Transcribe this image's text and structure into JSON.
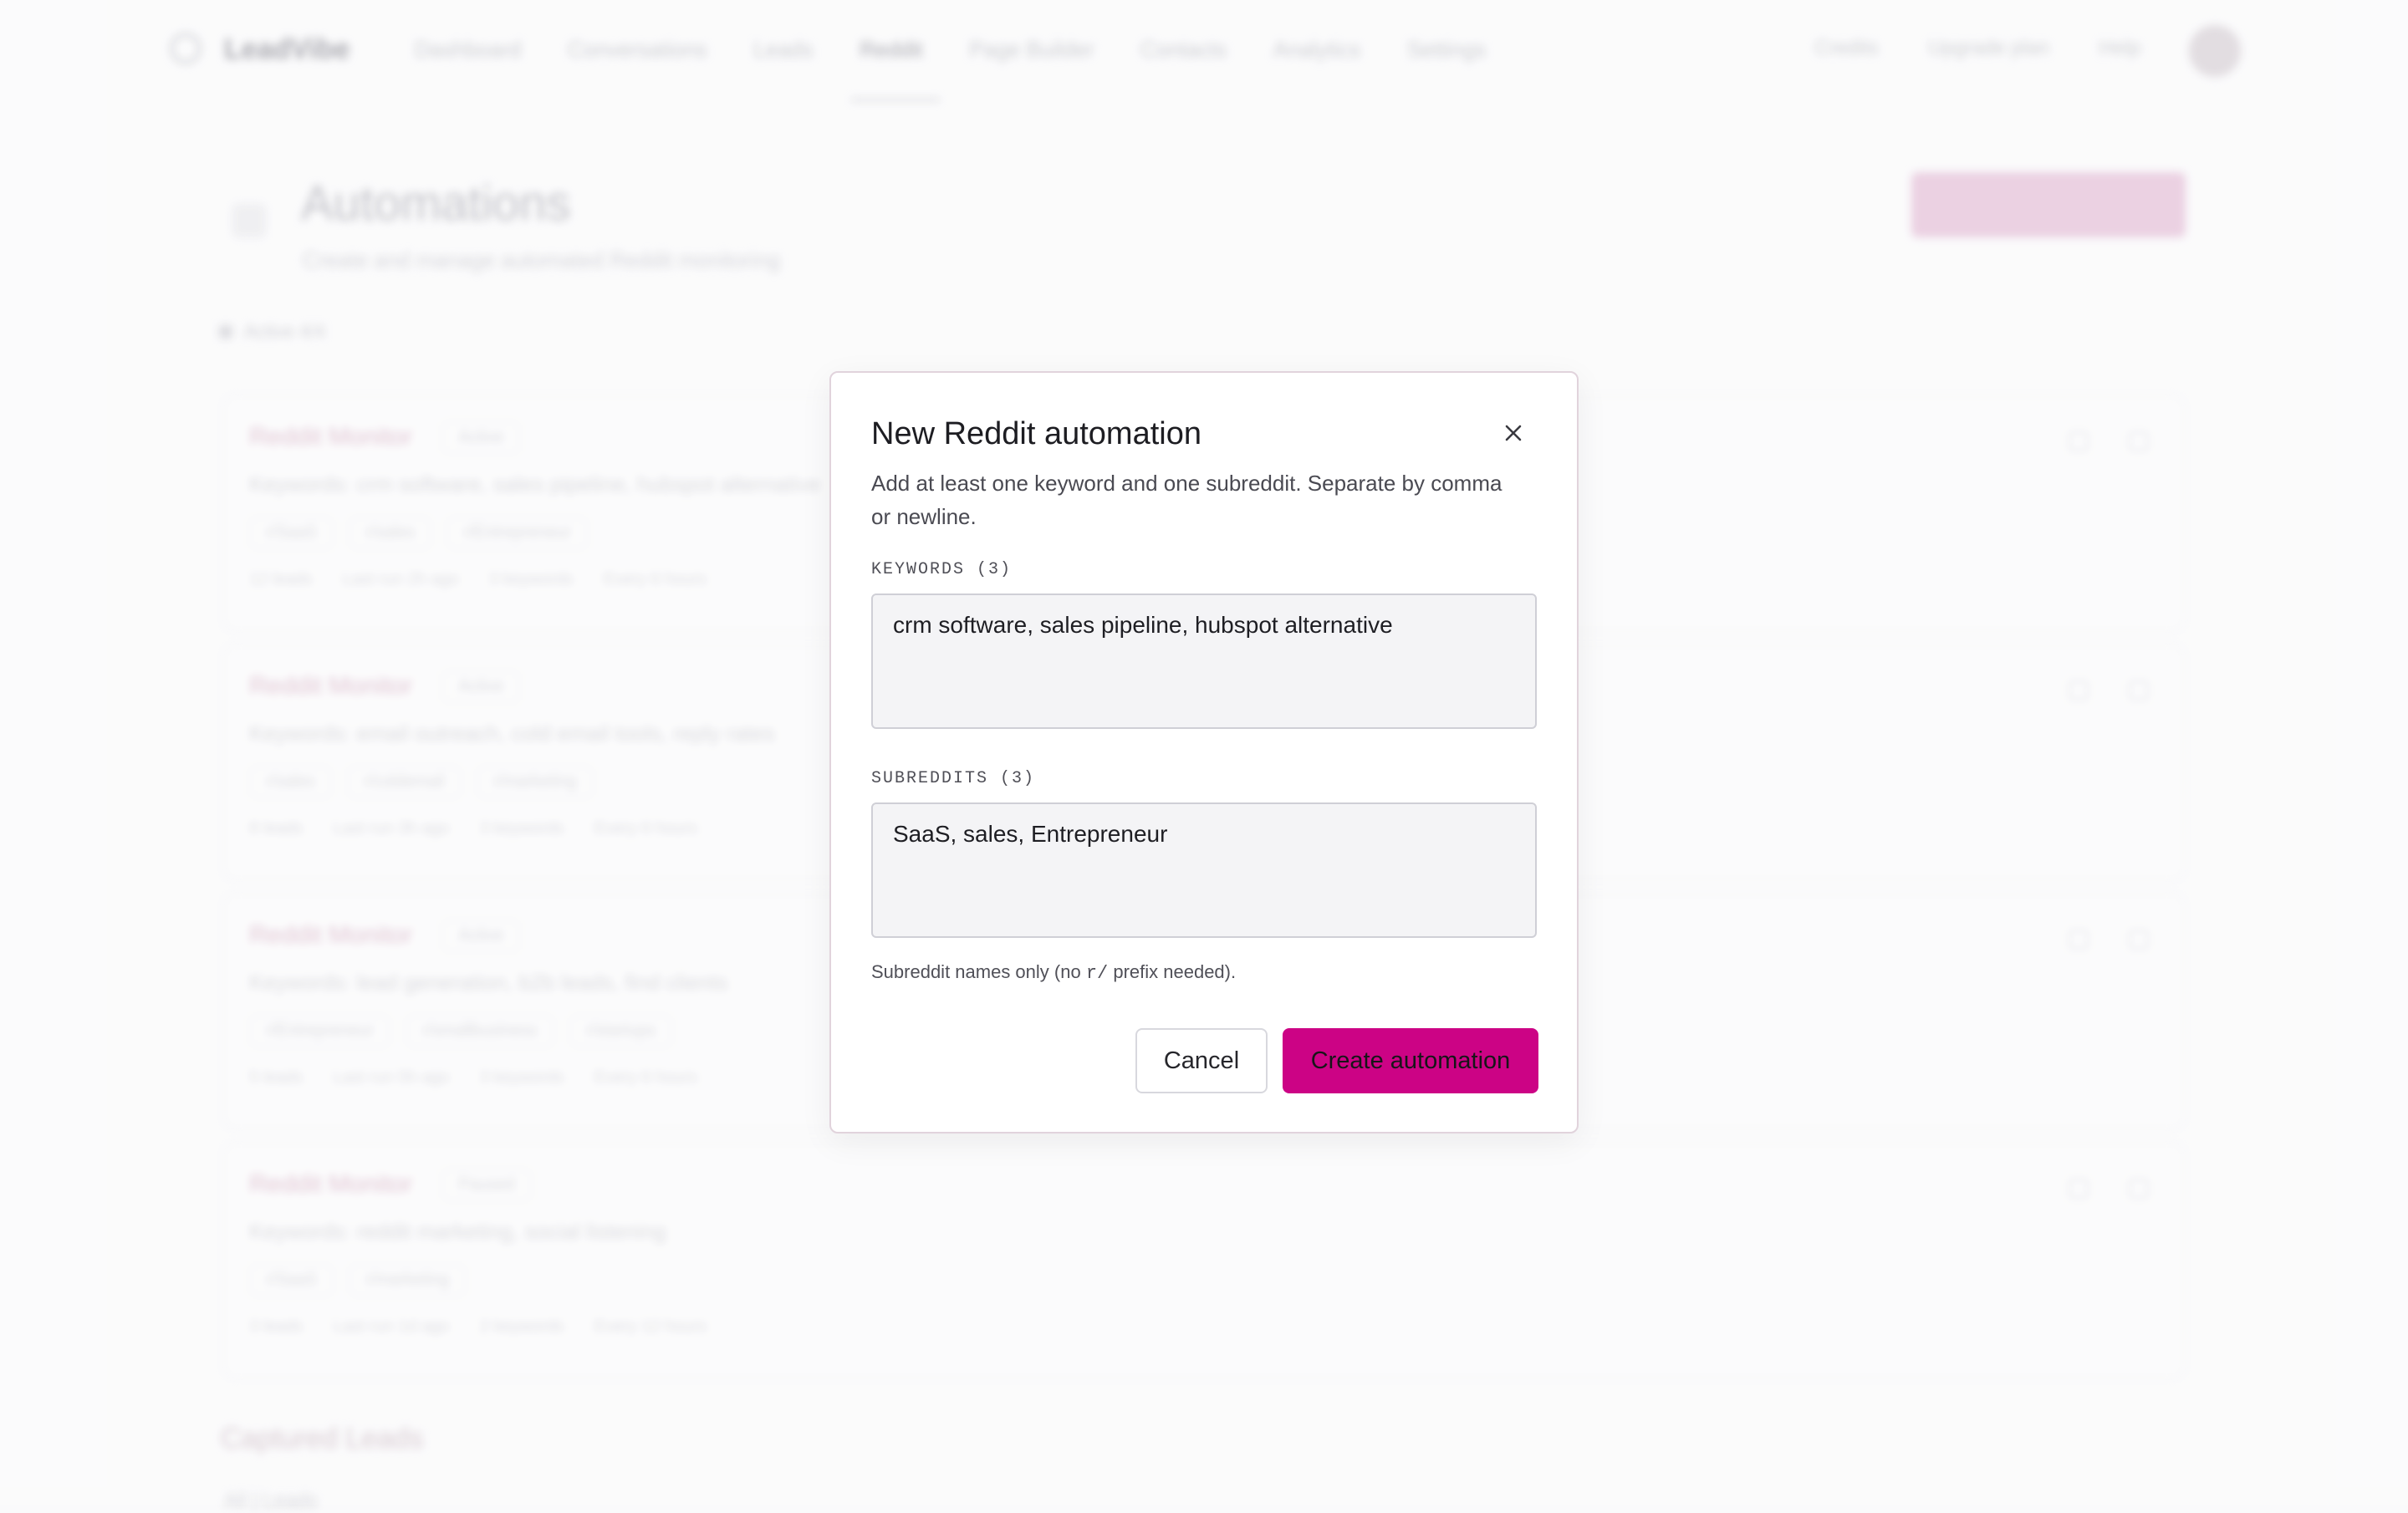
{
  "app": {
    "logo_text": "LeadVibe",
    "nav": [
      "Dashboard",
      "Conversations",
      "Leads",
      "Reddit",
      "Page Builder",
      "Contacts",
      "Analytics",
      "Settings"
    ],
    "nav_active": "Reddit",
    "right": [
      "Credits",
      "Upgrade plan",
      "Help"
    ]
  },
  "page": {
    "title": "Automations",
    "subtitle": "Create and manage automated Reddit monitoring",
    "filter_label": "Active  4/4"
  },
  "cards": [
    {
      "title": "Reddit Monitor",
      "badge": "Active",
      "desc": "Keywords: crm software, sales pipeline, hubspot alternative",
      "tags": [
        "r/SaaS",
        "r/sales",
        "r/Entrepreneur"
      ],
      "meta": [
        "12 leads",
        "Last run 2h ago",
        "3 keywords",
        "Every 6 hours"
      ]
    },
    {
      "title": "Reddit Monitor",
      "badge": "Active",
      "desc": "Keywords: email outreach, cold email tools, reply rates",
      "tags": [
        "r/sales",
        "r/coldemail",
        "r/marketing"
      ],
      "meta": [
        "8 leads",
        "Last run 3h ago",
        "3 keywords",
        "Every 6 hours"
      ]
    },
    {
      "title": "Reddit Monitor",
      "badge": "Active",
      "desc": "Keywords: lead generation, b2b leads, find clients",
      "tags": [
        "r/Entrepreneur",
        "r/smallbusiness",
        "r/startups"
      ],
      "meta": [
        "5 leads",
        "Last run 5h ago",
        "3 keywords",
        "Every 6 hours"
      ]
    },
    {
      "title": "Reddit Monitor",
      "badge": "Paused",
      "desc": "Keywords: reddit marketing, social listening",
      "tags": [
        "r/SaaS",
        "r/marketing"
      ],
      "meta": [
        "3 leads",
        "Last run 1d ago",
        "2 keywords",
        "Every 12 hours"
      ]
    }
  ],
  "section": {
    "title": "Captured Leads",
    "count": "All  |  Leads"
  },
  "modal": {
    "title": "New Reddit automation",
    "description": "Add at least one keyword and one subreddit. Separate by comma or newline.",
    "keywords_label": "KEYWORDS (3)",
    "keywords_value": "crm software, sales pipeline, hubspot alternative",
    "subreddits_label": "SUBREDDITS (3)",
    "subreddits_value": "SaaS, sales, Entrepreneur",
    "hint_before": "Subreddit names only (no ",
    "hint_code": "r/",
    "hint_after": " prefix needed).",
    "cancel_label": "Cancel",
    "create_label": "Create automation"
  },
  "colors": {
    "accent": "#cc0385"
  },
  "icons": {
    "close": "close-icon"
  }
}
